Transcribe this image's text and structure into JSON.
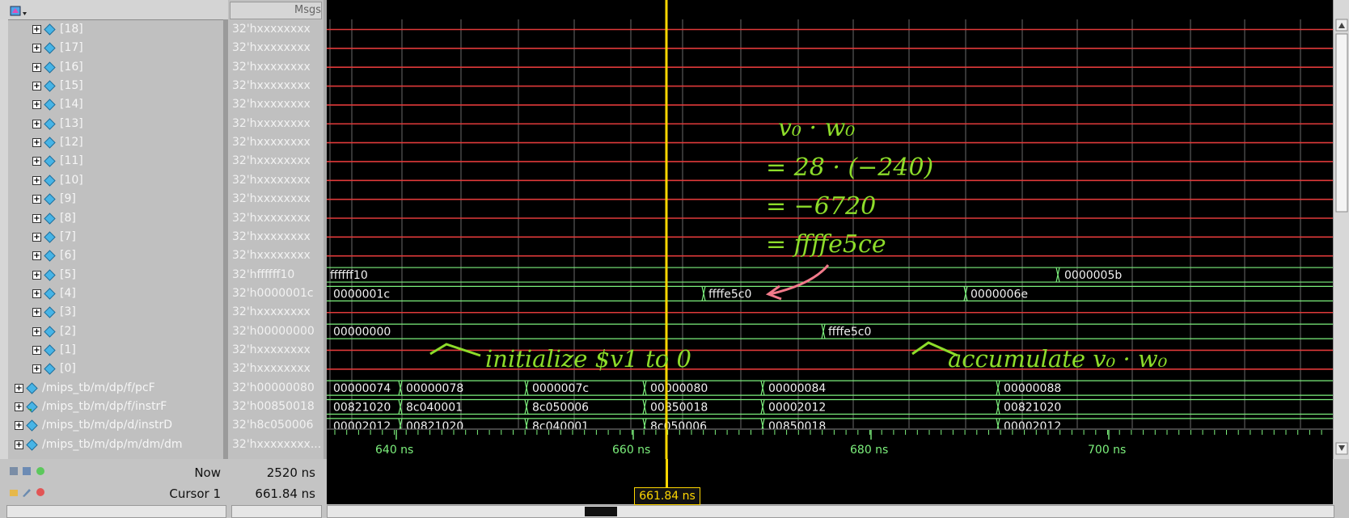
{
  "header": {
    "msgs_label": "Msgs"
  },
  "signals": [
    {
      "name": "[18]",
      "value": "32'hxxxxxxxx",
      "child": true,
      "icon": "bus-diamond-icon"
    },
    {
      "name": "[17]",
      "value": "32'hxxxxxxxx",
      "child": true,
      "icon": "bus-diamond-icon"
    },
    {
      "name": "[16]",
      "value": "32'hxxxxxxxx",
      "child": true,
      "icon": "bus-diamond-icon"
    },
    {
      "name": "[15]",
      "value": "32'hxxxxxxxx",
      "child": true,
      "icon": "bus-diamond-icon"
    },
    {
      "name": "[14]",
      "value": "32'hxxxxxxxx",
      "child": true,
      "icon": "bus-diamond-icon"
    },
    {
      "name": "[13]",
      "value": "32'hxxxxxxxx",
      "child": true,
      "icon": "bus-diamond-icon"
    },
    {
      "name": "[12]",
      "value": "32'hxxxxxxxx",
      "child": true,
      "icon": "bus-diamond-icon"
    },
    {
      "name": "[11]",
      "value": "32'hxxxxxxxx",
      "child": true,
      "icon": "bus-diamond-icon"
    },
    {
      "name": "[10]",
      "value": "32'hxxxxxxxx",
      "child": true,
      "icon": "bus-diamond-icon"
    },
    {
      "name": "[9]",
      "value": "32'hxxxxxxxx",
      "child": true,
      "icon": "bus-diamond-icon"
    },
    {
      "name": "[8]",
      "value": "32'hxxxxxxxx",
      "child": true,
      "icon": "bus-diamond-icon"
    },
    {
      "name": "[7]",
      "value": "32'hxxxxxxxx",
      "child": true,
      "icon": "bus-diamond-icon"
    },
    {
      "name": "[6]",
      "value": "32'hxxxxxxxx",
      "child": true,
      "icon": "bus-diamond-icon"
    },
    {
      "name": "[5]",
      "value": "32'hffffff10",
      "child": true,
      "icon": "bus-diamond-icon"
    },
    {
      "name": "[4]",
      "value": "32'h0000001c",
      "child": true,
      "icon": "bus-diamond-icon"
    },
    {
      "name": "[3]",
      "value": "32'hxxxxxxxx",
      "child": true,
      "icon": "bus-diamond-icon"
    },
    {
      "name": "[2]",
      "value": "32'h00000000",
      "child": true,
      "icon": "bus-diamond-icon"
    },
    {
      "name": "[1]",
      "value": "32'hxxxxxxxx",
      "child": true,
      "icon": "bus-diamond-icon"
    },
    {
      "name": "[0]",
      "value": "32'hxxxxxxxx",
      "child": true,
      "icon": "bus-diamond-icon"
    },
    {
      "name": "/mips_tb/m/dp/f/pcF",
      "value": "32'h00000080",
      "child": false,
      "icon": "bus-diamond-icon"
    },
    {
      "name": "/mips_tb/m/dp/f/instrF",
      "value": "32'h00850018",
      "child": false,
      "icon": "input-bus-icon"
    },
    {
      "name": "/mips_tb/m/dp/d/instrD",
      "value": "32'h8c050006",
      "child": false,
      "icon": "bus-diamond-icon"
    },
    {
      "name": "/mips_tb/m/dp/m/dm/dm",
      "value": "32'hxxxxxxxx...",
      "child": false,
      "icon": "bus-diamond-icon"
    }
  ],
  "waves": {
    "row5": [
      {
        "label": "ffffff10"
      },
      {
        "label": "0000005b"
      }
    ],
    "row4": [
      {
        "label": "0000001c"
      },
      {
        "label": "ffffe5c0"
      },
      {
        "label": "0000006e"
      }
    ],
    "row2": [
      {
        "label": "00000000"
      },
      {
        "label": "ffffe5c0"
      }
    ],
    "pcF": [
      "00000074",
      "00000078",
      "0000007c",
      "00000080",
      "00000084",
      "00000088"
    ],
    "instrF": [
      "00821020",
      "8c040001",
      "8c050006",
      "00850018",
      "00002012",
      "00821020"
    ],
    "instrD": [
      "00002012",
      "00821020",
      "8c040001",
      "8c050006",
      "00850018",
      "00002012"
    ],
    "dm": "xxxxxxxx xxxxxxxx xxxxxxxx xxxxxxxx xxxxxxxx xxxxxxxx xxxxxxxx xxxxxxxx xxxxxxxx xxxxxxxx xxxxxxxx xxxxxxxx xxxxxxxx xxxxxxxx xxxxxxxx xxxxxxxx xxx..."
  },
  "annotations": {
    "line1": "v₀ · w₀",
    "line2": "= 28 · (−240)",
    "line3": "= −6720",
    "line4": "= ffffe5ce",
    "note_initialize": "initialize $v1 to 0",
    "note_accumulate": "accumulate v₀ · w₀"
  },
  "timeline": {
    "ticks": [
      "640 ns",
      "660 ns",
      "680 ns",
      "700 ns"
    ],
    "cursor_time": "661.84 ns"
  },
  "bottom": {
    "now_label": "Now",
    "now_value": "2520 ns",
    "cursor_label": "Cursor 1",
    "cursor_value": "661.84 ns"
  },
  "colors": {
    "wave_green": "#7cf07c",
    "x_red": "#e03a3a",
    "cursor": "#ffd700",
    "grid": "#6a6a6a",
    "annotation_green": "#8ddc2a",
    "arrow_pink": "#f27a8a"
  }
}
